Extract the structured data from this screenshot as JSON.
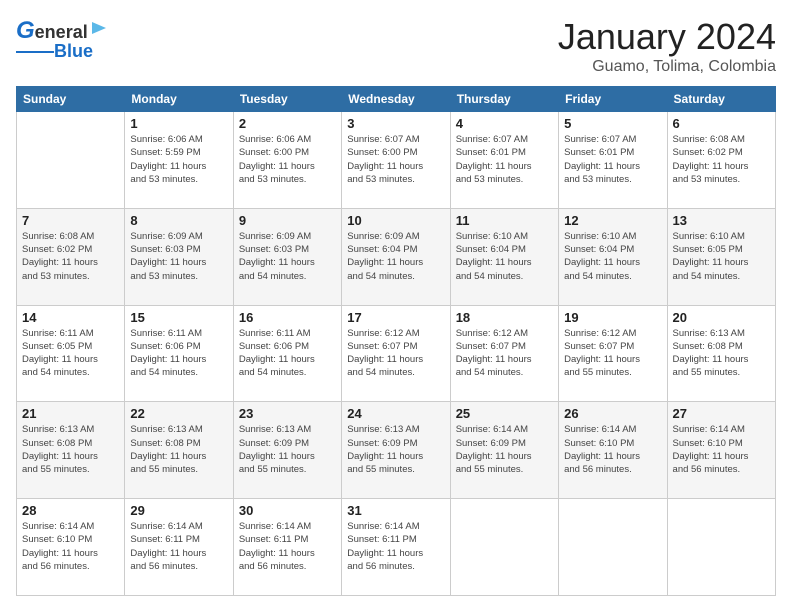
{
  "header": {
    "logo_line1": "General",
    "logo_line2": "Blue",
    "title": "January 2024",
    "subtitle": "Guamo, Tolima, Colombia"
  },
  "columns": [
    "Sunday",
    "Monday",
    "Tuesday",
    "Wednesday",
    "Thursday",
    "Friday",
    "Saturday"
  ],
  "weeks": [
    [
      {
        "num": "",
        "info": ""
      },
      {
        "num": "1",
        "info": "Sunrise: 6:06 AM\nSunset: 5:59 PM\nDaylight: 11 hours\nand 53 minutes."
      },
      {
        "num": "2",
        "info": "Sunrise: 6:06 AM\nSunset: 6:00 PM\nDaylight: 11 hours\nand 53 minutes."
      },
      {
        "num": "3",
        "info": "Sunrise: 6:07 AM\nSunset: 6:00 PM\nDaylight: 11 hours\nand 53 minutes."
      },
      {
        "num": "4",
        "info": "Sunrise: 6:07 AM\nSunset: 6:01 PM\nDaylight: 11 hours\nand 53 minutes."
      },
      {
        "num": "5",
        "info": "Sunrise: 6:07 AM\nSunset: 6:01 PM\nDaylight: 11 hours\nand 53 minutes."
      },
      {
        "num": "6",
        "info": "Sunrise: 6:08 AM\nSunset: 6:02 PM\nDaylight: 11 hours\nand 53 minutes."
      }
    ],
    [
      {
        "num": "7",
        "info": "Sunrise: 6:08 AM\nSunset: 6:02 PM\nDaylight: 11 hours\nand 53 minutes."
      },
      {
        "num": "8",
        "info": "Sunrise: 6:09 AM\nSunset: 6:03 PM\nDaylight: 11 hours\nand 53 minutes."
      },
      {
        "num": "9",
        "info": "Sunrise: 6:09 AM\nSunset: 6:03 PM\nDaylight: 11 hours\nand 54 minutes."
      },
      {
        "num": "10",
        "info": "Sunrise: 6:09 AM\nSunset: 6:04 PM\nDaylight: 11 hours\nand 54 minutes."
      },
      {
        "num": "11",
        "info": "Sunrise: 6:10 AM\nSunset: 6:04 PM\nDaylight: 11 hours\nand 54 minutes."
      },
      {
        "num": "12",
        "info": "Sunrise: 6:10 AM\nSunset: 6:04 PM\nDaylight: 11 hours\nand 54 minutes."
      },
      {
        "num": "13",
        "info": "Sunrise: 6:10 AM\nSunset: 6:05 PM\nDaylight: 11 hours\nand 54 minutes."
      }
    ],
    [
      {
        "num": "14",
        "info": "Sunrise: 6:11 AM\nSunset: 6:05 PM\nDaylight: 11 hours\nand 54 minutes."
      },
      {
        "num": "15",
        "info": "Sunrise: 6:11 AM\nSunset: 6:06 PM\nDaylight: 11 hours\nand 54 minutes."
      },
      {
        "num": "16",
        "info": "Sunrise: 6:11 AM\nSunset: 6:06 PM\nDaylight: 11 hours\nand 54 minutes."
      },
      {
        "num": "17",
        "info": "Sunrise: 6:12 AM\nSunset: 6:07 PM\nDaylight: 11 hours\nand 54 minutes."
      },
      {
        "num": "18",
        "info": "Sunrise: 6:12 AM\nSunset: 6:07 PM\nDaylight: 11 hours\nand 54 minutes."
      },
      {
        "num": "19",
        "info": "Sunrise: 6:12 AM\nSunset: 6:07 PM\nDaylight: 11 hours\nand 55 minutes."
      },
      {
        "num": "20",
        "info": "Sunrise: 6:13 AM\nSunset: 6:08 PM\nDaylight: 11 hours\nand 55 minutes."
      }
    ],
    [
      {
        "num": "21",
        "info": "Sunrise: 6:13 AM\nSunset: 6:08 PM\nDaylight: 11 hours\nand 55 minutes."
      },
      {
        "num": "22",
        "info": "Sunrise: 6:13 AM\nSunset: 6:08 PM\nDaylight: 11 hours\nand 55 minutes."
      },
      {
        "num": "23",
        "info": "Sunrise: 6:13 AM\nSunset: 6:09 PM\nDaylight: 11 hours\nand 55 minutes."
      },
      {
        "num": "24",
        "info": "Sunrise: 6:13 AM\nSunset: 6:09 PM\nDaylight: 11 hours\nand 55 minutes."
      },
      {
        "num": "25",
        "info": "Sunrise: 6:14 AM\nSunset: 6:09 PM\nDaylight: 11 hours\nand 55 minutes."
      },
      {
        "num": "26",
        "info": "Sunrise: 6:14 AM\nSunset: 6:10 PM\nDaylight: 11 hours\nand 56 minutes."
      },
      {
        "num": "27",
        "info": "Sunrise: 6:14 AM\nSunset: 6:10 PM\nDaylight: 11 hours\nand 56 minutes."
      }
    ],
    [
      {
        "num": "28",
        "info": "Sunrise: 6:14 AM\nSunset: 6:10 PM\nDaylight: 11 hours\nand 56 minutes."
      },
      {
        "num": "29",
        "info": "Sunrise: 6:14 AM\nSunset: 6:11 PM\nDaylight: 11 hours\nand 56 minutes."
      },
      {
        "num": "30",
        "info": "Sunrise: 6:14 AM\nSunset: 6:11 PM\nDaylight: 11 hours\nand 56 minutes."
      },
      {
        "num": "31",
        "info": "Sunrise: 6:14 AM\nSunset: 6:11 PM\nDaylight: 11 hours\nand 56 minutes."
      },
      {
        "num": "",
        "info": ""
      },
      {
        "num": "",
        "info": ""
      },
      {
        "num": "",
        "info": ""
      }
    ]
  ]
}
